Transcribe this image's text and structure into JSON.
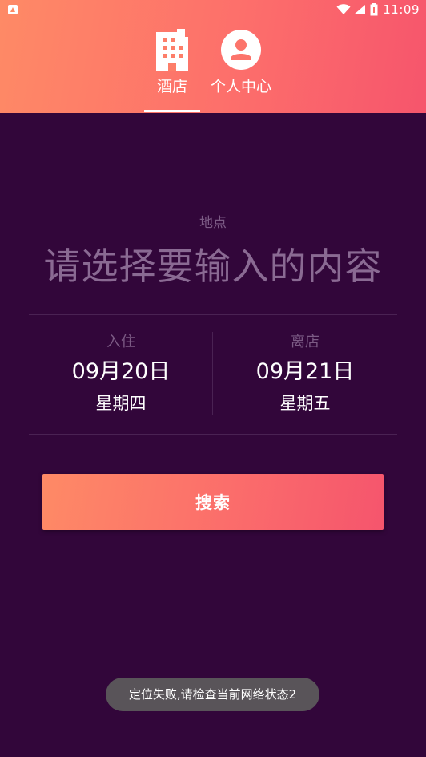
{
  "status_bar": {
    "time": "11:09",
    "icons": [
      "app-notification-icon",
      "wifi-icon",
      "signal-icon",
      "battery-icon"
    ]
  },
  "tabs": [
    {
      "label": "酒店",
      "icon": "hotel-building-icon",
      "selected": true
    },
    {
      "label": "个人中心",
      "icon": "person-avatar-icon",
      "selected": false
    }
  ],
  "search_form": {
    "location_label": "地点",
    "location_placeholder": "请选择要输入的内容",
    "checkin": {
      "label": "入住",
      "date": "09月20日",
      "weekday": "星期四"
    },
    "checkout": {
      "label": "离店",
      "date": "09月21日",
      "weekday": "星期五"
    },
    "search_button_label": "搜索"
  },
  "toast": {
    "message": "定位失败,请检查当前网络状态2"
  },
  "colors": {
    "header_gradient_start": "#fe8a66",
    "header_gradient_end": "#f6556c",
    "background": "#32063a",
    "muted_text": "#7c5b85"
  }
}
